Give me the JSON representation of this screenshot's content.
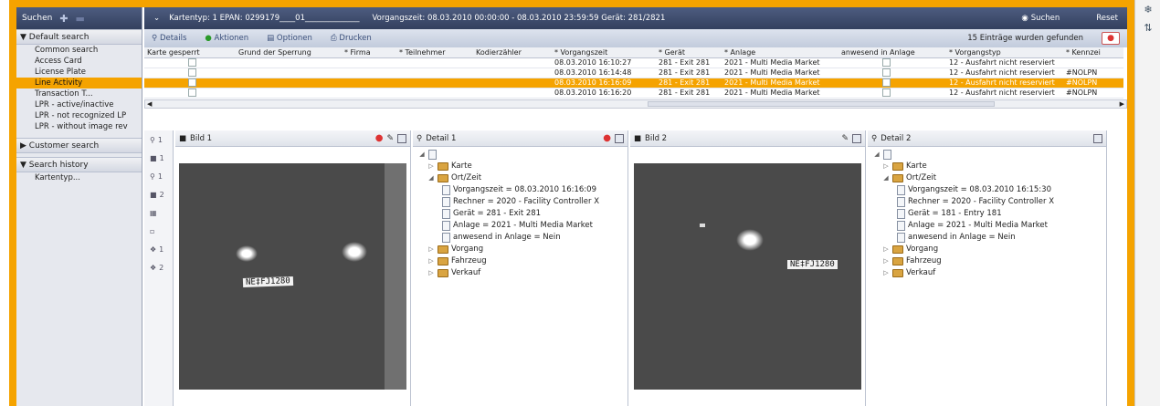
{
  "nav": {
    "top_label": "Suchen",
    "groups": [
      {
        "label": "▼ Default search",
        "items": [
          "Common search",
          "Access Card",
          "License Plate",
          "Line Activity",
          "Transaction T...",
          "LPR - active/inactive",
          "LPR - not recognized LP",
          "LPR - without image rev"
        ],
        "selected": 3
      },
      {
        "label": "▶ Customer search",
        "items": []
      },
      {
        "label": "▼ Search history",
        "items": [
          "Kartentyp..."
        ]
      }
    ]
  },
  "header": {
    "filter": "Kartentyp: 1  EPAN: 0299179____01______________",
    "range": "Vorgangszeit: 08.03.2010 00:00:00 - 08.03.2010 23:59:59  Gerät: 281/2821",
    "search_btn": "Suchen",
    "reset_btn": "Reset"
  },
  "toolbar": {
    "details": "Details",
    "actions": "Aktionen",
    "options": "Optionen",
    "print": "Drucken",
    "found": "15 Einträge wurden gefunden"
  },
  "table": {
    "columns": [
      "Karte gesperrt",
      "Grund der Sperrung",
      "* Firma",
      "* Teilnehmer",
      "Kodierzähler",
      "* Vorgangszeit",
      "* Gerät",
      "* Anlage",
      "anwesend in Anlage",
      "* Vorgangstyp",
      "* Kennzei"
    ],
    "rows": [
      [
        "",
        "",
        "",
        "",
        "",
        "08.03.2010 16:10:27",
        "281 - Exit 281",
        "2021 - Multi Media Market",
        "",
        "12 - Ausfahrt nicht reserviert",
        ""
      ],
      [
        "",
        "",
        "",
        "",
        "",
        "08.03.2010 16:14:48",
        "281 - Exit 281",
        "2021 - Multi Media Market",
        "",
        "12 - Ausfahrt nicht reserviert",
        "#NOLPN"
      ],
      [
        "",
        "",
        "",
        "",
        "",
        "08.03.2010 16:16:09",
        "281 - Exit 281",
        "2021 - Multi Media Market",
        "",
        "12 - Ausfahrt nicht reserviert",
        "#NOLPN"
      ],
      [
        "",
        "",
        "",
        "",
        "",
        "08.03.2010 16:16:20",
        "281 - Exit 281",
        "2021 - Multi Media Market",
        "",
        "12 - Ausfahrt nicht reserviert",
        "#NOLPN"
      ]
    ],
    "selected": 2
  },
  "iconcol": [
    "1",
    "1",
    "1",
    "2",
    "2",
    "",
    "",
    "1",
    "2"
  ],
  "panels": {
    "bild1": {
      "title": "Bild 1",
      "plate": "NE‡FJ1280"
    },
    "detail1": {
      "title": "Detail 1",
      "karte": "Karte",
      "ortzeit": "Ort/Zeit",
      "lines": [
        "Vorgangszeit = 08.03.2010 16:16:09",
        "Rechner = 2020 - Facility Controller X",
        "Gerät = 281 - Exit 281",
        "Anlage = 2021 - Multi Media Market",
        "anwesend in Anlage = Nein"
      ],
      "vorgang": "Vorgang",
      "fahrzeug": "Fahrzeug",
      "verkauf": "Verkauf"
    },
    "bild2": {
      "title": "Bild 2",
      "plate": "NE‡FJ1280"
    },
    "detail2": {
      "title": "Detail 2",
      "karte": "Karte",
      "ortzeit": "Ort/Zeit",
      "lines": [
        "Vorgangszeit = 08.03.2010 16:15:30",
        "Rechner = 2020 - Facility Controller X",
        "Gerät = 181 - Entry 181",
        "Anlage = 2021 - Multi Media Market",
        "anwesend in Anlage = Nein"
      ],
      "vorgang": "Vorgang",
      "fahrzeug": "Fahrzeug",
      "verkauf": "Verkauf"
    }
  },
  "colors": {
    "accent": "#f5a300",
    "header": "#3d4a6b"
  }
}
